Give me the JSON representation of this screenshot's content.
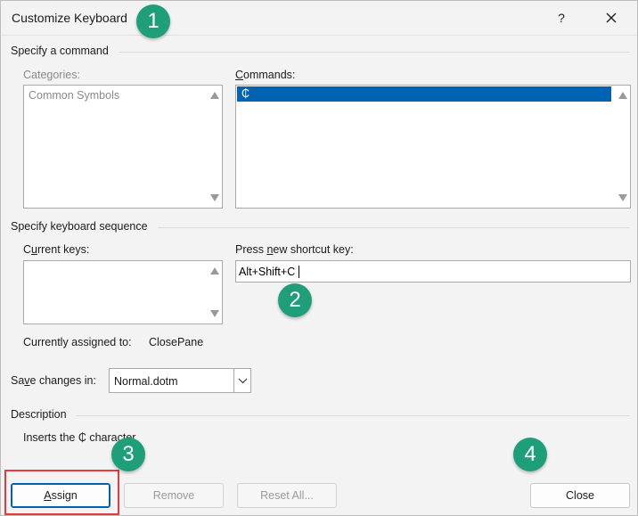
{
  "window": {
    "title": "Customize Keyboard",
    "help_glyph": "?",
    "close_glyph_name": "close-icon"
  },
  "specify_command": {
    "group_label": "Specify a command",
    "categories_label": "Categories:",
    "categories_items": [
      "Common Symbols"
    ],
    "commands_label": "Commands:",
    "commands_items": [
      "₵"
    ]
  },
  "keyboard_sequence": {
    "group_label": "Specify keyboard sequence",
    "current_keys_label": "Current keys:",
    "press_new_label": "Press new shortcut key:",
    "new_shortcut_value": "Alt+Shift+C",
    "assigned_label": "Currently assigned to:",
    "assigned_value": "ClosePane"
  },
  "save": {
    "label": "Save changes in:",
    "value": "Normal.dotm"
  },
  "description": {
    "group_label": "Description",
    "text": "Inserts the ₵ character"
  },
  "buttons": {
    "assign": "Assign",
    "remove": "Remove",
    "reset_all": "Reset All...",
    "close": "Close"
  },
  "callouts": [
    "1",
    "2",
    "3",
    "4"
  ],
  "colors": {
    "selection": "#0063b1",
    "callout": "#1f9e7a",
    "highlight": "#e8393b"
  }
}
